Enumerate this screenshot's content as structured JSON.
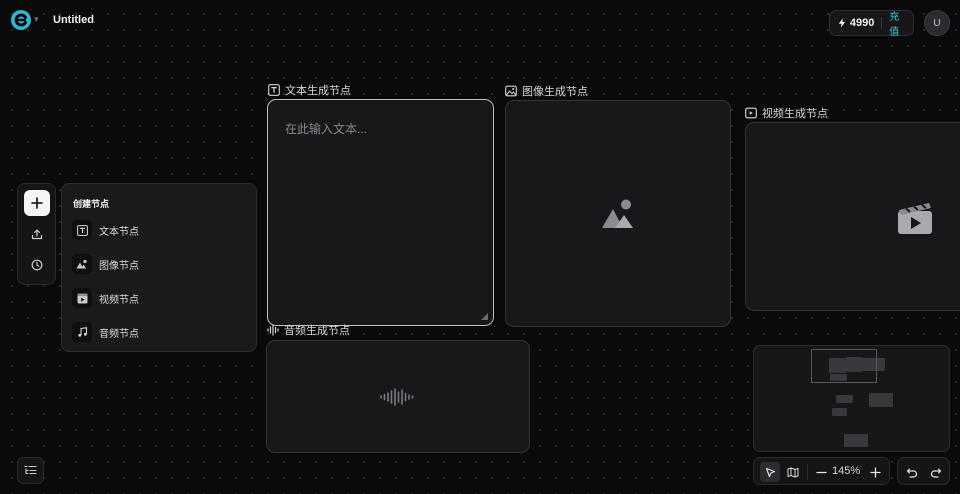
{
  "header": {
    "title": "Untitled",
    "credits": {
      "amount": "4990",
      "recharge_label": "充值"
    },
    "avatar_initial": "U"
  },
  "toolbar": {
    "items": [
      "plus-icon",
      "upload-icon",
      "history-clock-icon"
    ]
  },
  "create_menu": {
    "title": "创建节点",
    "items": [
      {
        "label": "文本节点",
        "icon": "text-icon"
      },
      {
        "label": "图像节点",
        "icon": "image-icon"
      },
      {
        "label": "视频节点",
        "icon": "video-icon"
      },
      {
        "label": "音频节点",
        "icon": "music-note-icon"
      }
    ]
  },
  "nodes": {
    "text": {
      "label": "文本生成节点",
      "placeholder": "在此输入文本..."
    },
    "image": {
      "label": "图像生成节点"
    },
    "video": {
      "label": "视频生成节点"
    },
    "audio": {
      "label": "音频生成节点"
    }
  },
  "controls": {
    "zoom": "145%"
  },
  "colors": {
    "accent": "#37c9d6",
    "background": "#0a0a0b",
    "card": "#18181b"
  }
}
